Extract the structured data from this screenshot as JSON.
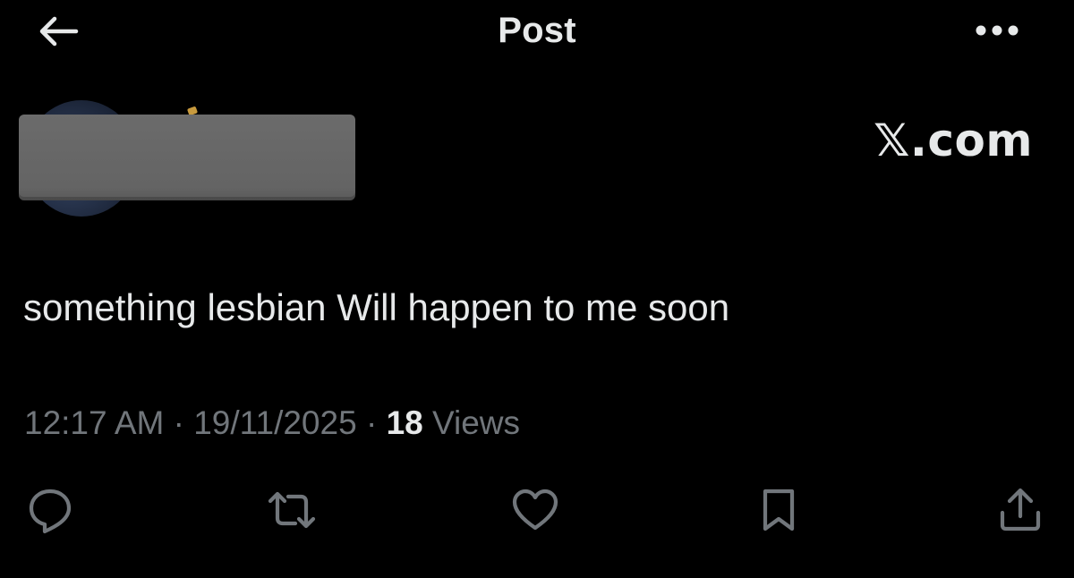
{
  "header": {
    "title": "Post",
    "back_icon": "arrow-left-icon",
    "more_icon": "more-horizontal-icon"
  },
  "post": {
    "watermark": "𝕏.com",
    "text": "something lesbian Will happen to me soon",
    "time": "12:17 AM",
    "separator": "·",
    "date": "19/11/2025",
    "views_count": "18",
    "views_label": "Views"
  },
  "actions": {
    "reply_icon": "reply-icon",
    "repost_icon": "repost-icon",
    "like_icon": "heart-icon",
    "bookmark_icon": "bookmark-icon",
    "share_icon": "share-icon"
  },
  "colors": {
    "background": "#000000",
    "primary_text": "#e7e9ea",
    "secondary_text": "#71767b",
    "redaction": "#666666"
  }
}
